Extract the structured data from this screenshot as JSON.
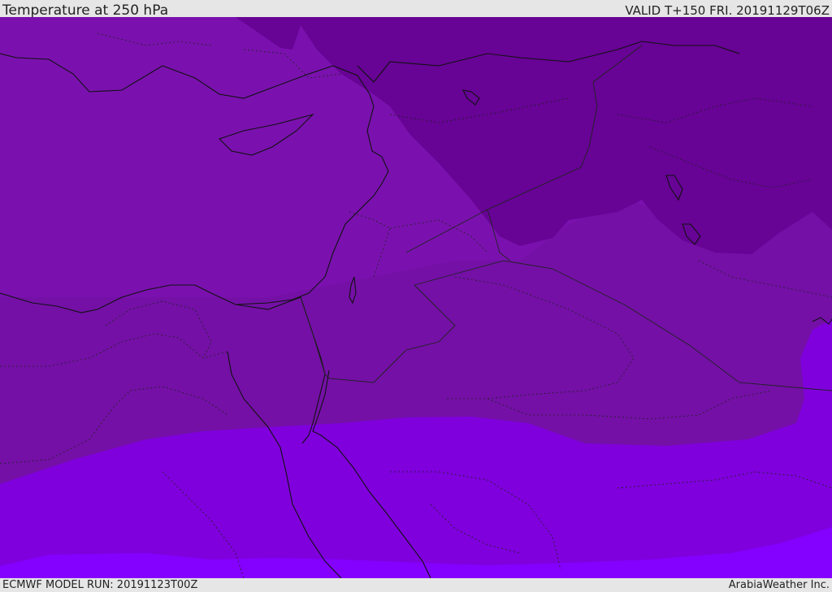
{
  "header": {
    "title": "Temperature at 250 hPa",
    "valid_time": "VALID T+150 FRI. 20191129T06Z"
  },
  "footer": {
    "model_run": "ECMWF MODEL RUN: 20191123T00Z",
    "credit": "ArabiaWeather Inc."
  },
  "map": {
    "colors": {
      "darkest_band": "#670395",
      "dark_band": "#7613ac",
      "mid_band": "#7a11ae",
      "mid2_band": "#7410a6",
      "light_band": "#7f00dc",
      "lightest_band": "#8400ff",
      "coastline": "#111111",
      "border": "#222222"
    }
  }
}
